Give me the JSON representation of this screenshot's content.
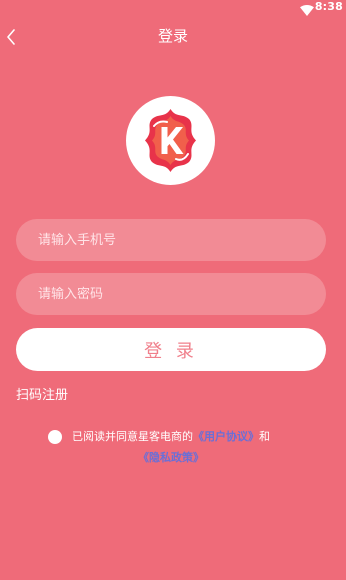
{
  "status_bar": {
    "time": "8:38",
    "wifi_icon": "wifi-icon"
  },
  "header": {
    "back_icon": "back-chevron-icon",
    "title": "登录"
  },
  "logo": {
    "icon": "app-logo-k-icon",
    "letter": "K"
  },
  "form": {
    "phone_placeholder": "请输入手机号",
    "phone_value": "",
    "password_placeholder": "请输入密码",
    "password_value": "",
    "login_label": "登 录"
  },
  "links": {
    "scan_register": "扫码注册"
  },
  "agreement": {
    "checked": false,
    "prefix": "已阅读并同意星客电商的",
    "user_agreement": "《用户协议》",
    "conjunction": "和",
    "privacy_policy": "《隐私政策》"
  },
  "colors": {
    "background": "#ef6b79",
    "field_background": "#f28b95",
    "button_text": "#f0808c",
    "link": "#6b6fd6",
    "logo_red": "#e8334a"
  }
}
